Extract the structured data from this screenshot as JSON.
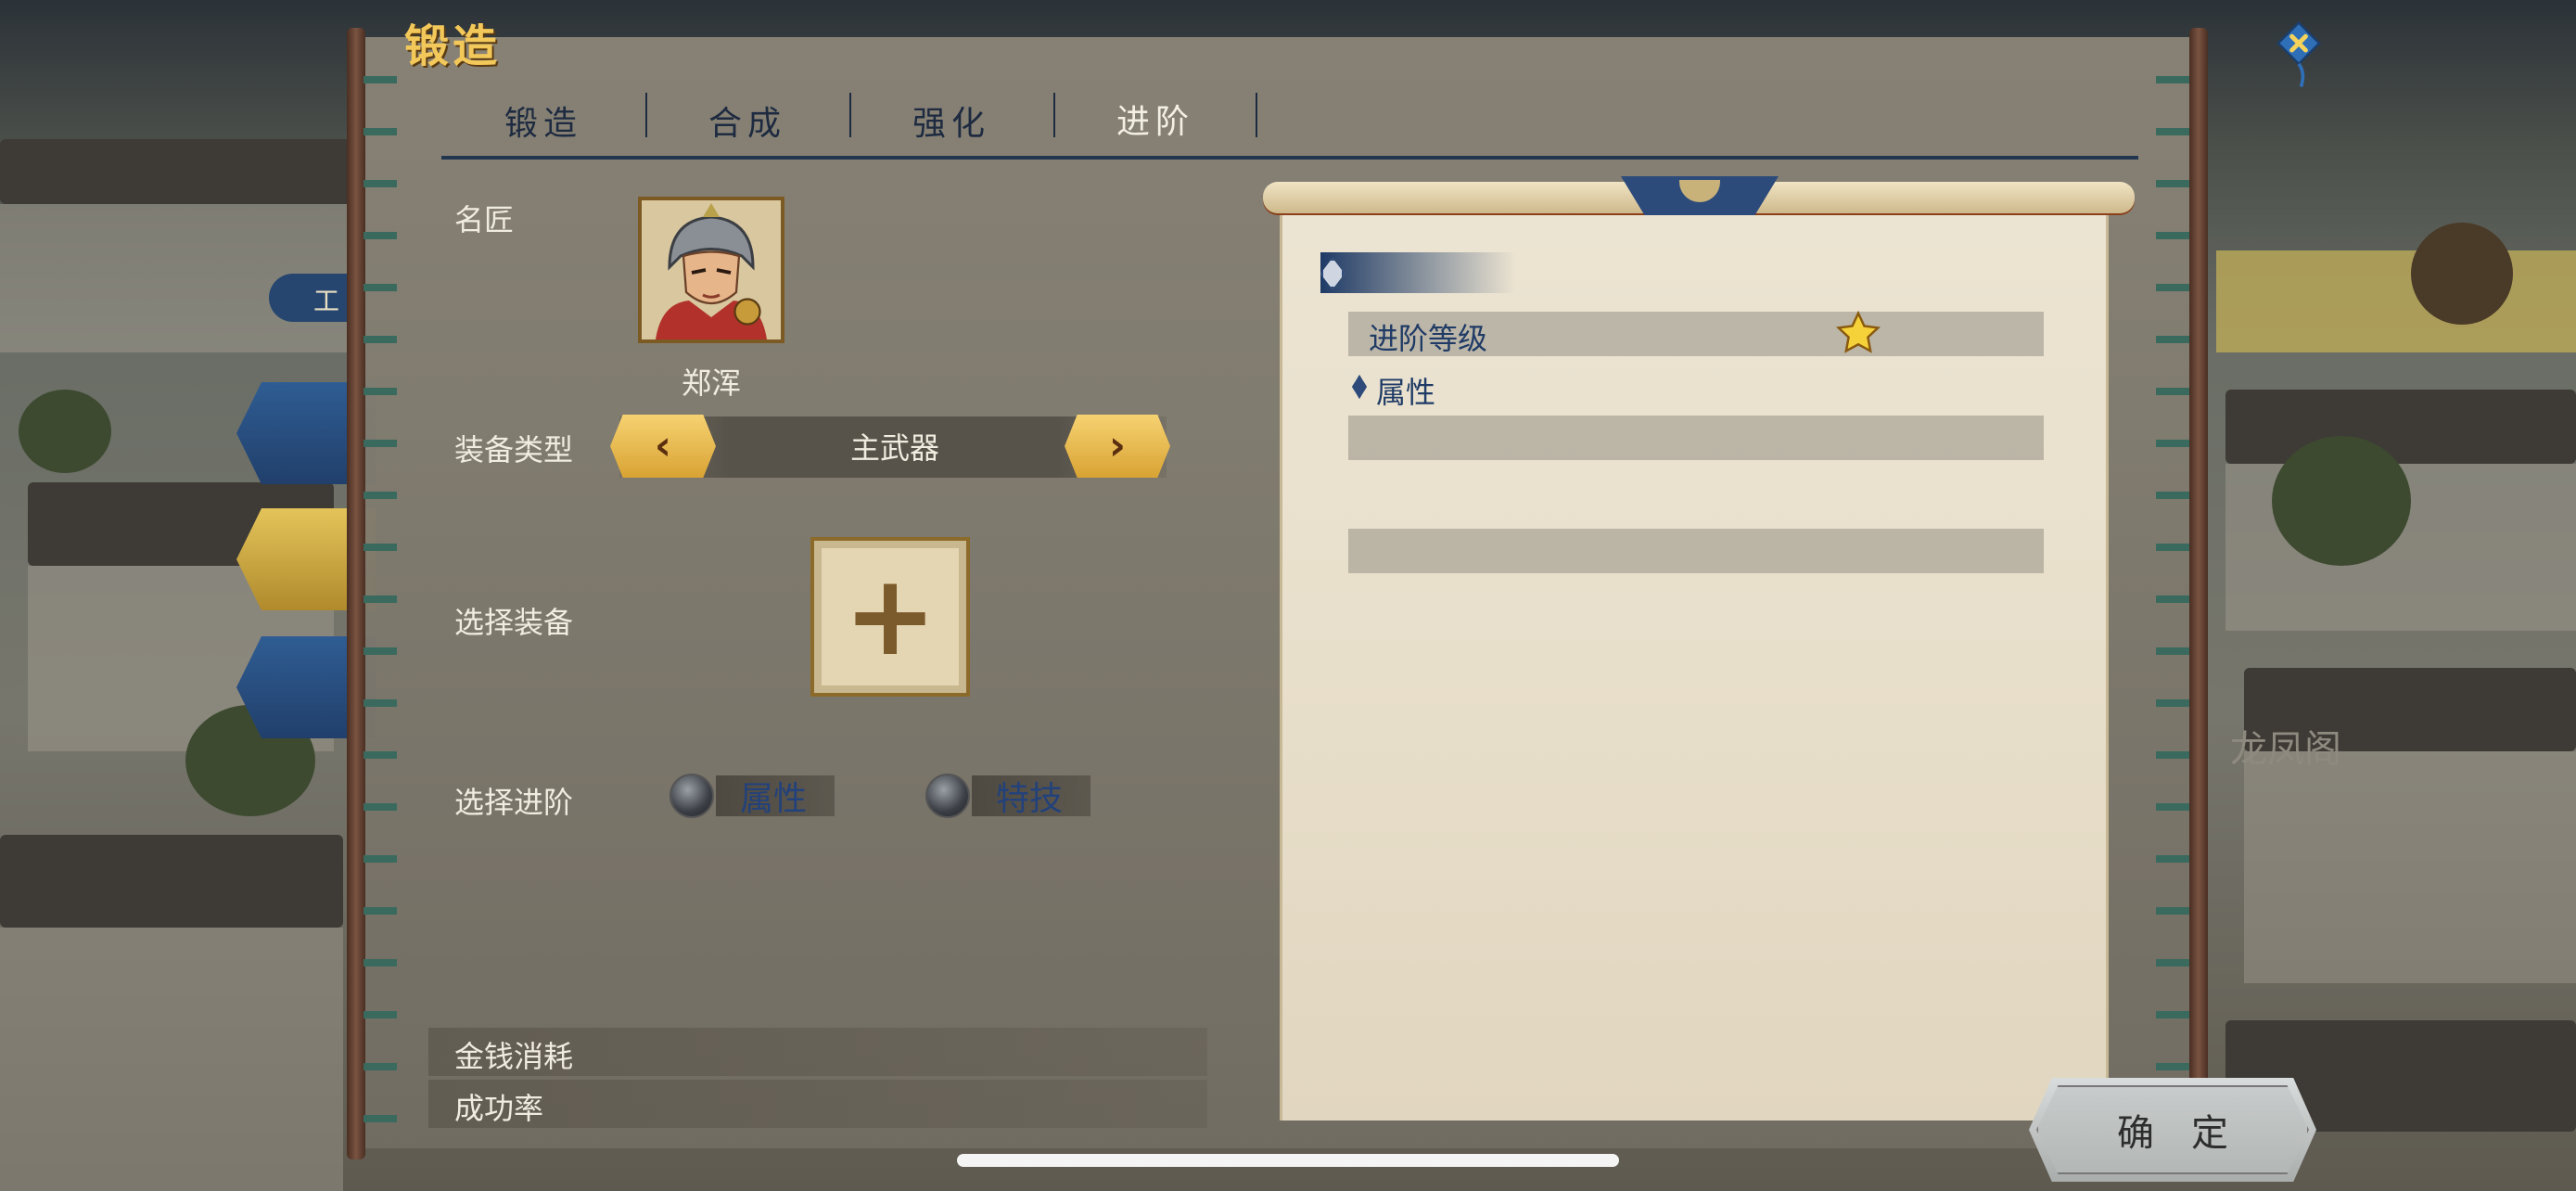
{
  "panel": {
    "title": "锻造"
  },
  "tabs": [
    {
      "label": "锻造",
      "active": false
    },
    {
      "label": "合成",
      "active": false
    },
    {
      "label": "强化",
      "active": false
    },
    {
      "label": "进阶",
      "active": true
    }
  ],
  "craftsman": {
    "label": "名匠",
    "name": "郑浑"
  },
  "equip_type": {
    "label": "装备类型",
    "value": "主武器"
  },
  "select_equip": {
    "label": "选择装备"
  },
  "select_advance": {
    "label": "选择进阶",
    "options": [
      {
        "label": "属性",
        "selected": false
      },
      {
        "label": "特技",
        "selected": false
      }
    ]
  },
  "cost": {
    "money_label": "金钱消耗",
    "success_label": "成功率"
  },
  "detail": {
    "advance_level_label": "进阶等级",
    "advance_stars": 1,
    "attributes_label": "属性"
  },
  "confirm": {
    "label": "确定"
  },
  "background": {
    "sidebar_tag": "工",
    "building_label": "龙凤阁"
  },
  "colors": {
    "accent_gold": "#f3c85a",
    "accent_navy": "#1f3b66",
    "text_light": "#f1ece0"
  }
}
